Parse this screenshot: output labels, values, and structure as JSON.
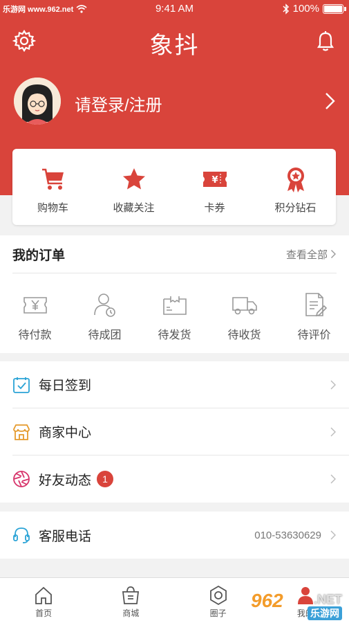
{
  "status_bar": {
    "site": "乐游网 www.962.net",
    "time": "9:41 AM",
    "battery": "100%",
    "battery_level": 1.0
  },
  "header": {
    "title": "象抖"
  },
  "profile": {
    "login_text": "请登录/注册"
  },
  "quick_actions": [
    {
      "label": "购物车",
      "icon": "cart-icon"
    },
    {
      "label": "收藏关注",
      "icon": "star-icon"
    },
    {
      "label": "卡券",
      "icon": "coupon-icon"
    },
    {
      "label": "积分钻石",
      "icon": "medal-icon"
    }
  ],
  "orders": {
    "title": "我的订单",
    "view_all": "查看全部",
    "items": [
      {
        "label": "待付款",
        "icon": "wallet-icon"
      },
      {
        "label": "待成团",
        "icon": "group-icon"
      },
      {
        "label": "待发货",
        "icon": "package-icon"
      },
      {
        "label": "待收货",
        "icon": "truck-icon"
      },
      {
        "label": "待评价",
        "icon": "review-icon"
      }
    ]
  },
  "menu": {
    "checkin": "每日签到",
    "merchant": "商家中心",
    "friends": "好友动态",
    "friends_badge": "1",
    "service": "客服电话",
    "service_phone": "010-53630629"
  },
  "tabbar": [
    {
      "label": "首页",
      "icon": "home-icon"
    },
    {
      "label": "商城",
      "icon": "shop-bag-icon"
    },
    {
      "label": "圈子",
      "icon": "hexagon-icon"
    },
    {
      "label": "我的",
      "icon": "profile-icon"
    }
  ],
  "watermark": {
    "number": "962",
    "suffix": ".NET",
    "name": "乐游网"
  },
  "colors": {
    "brand_red": "#d9443b",
    "checkin_blue": "#2aa3d6",
    "merchant_orange": "#e59a2c",
    "friends_pink": "#d7336a",
    "service_blue": "#2aa3d6"
  }
}
